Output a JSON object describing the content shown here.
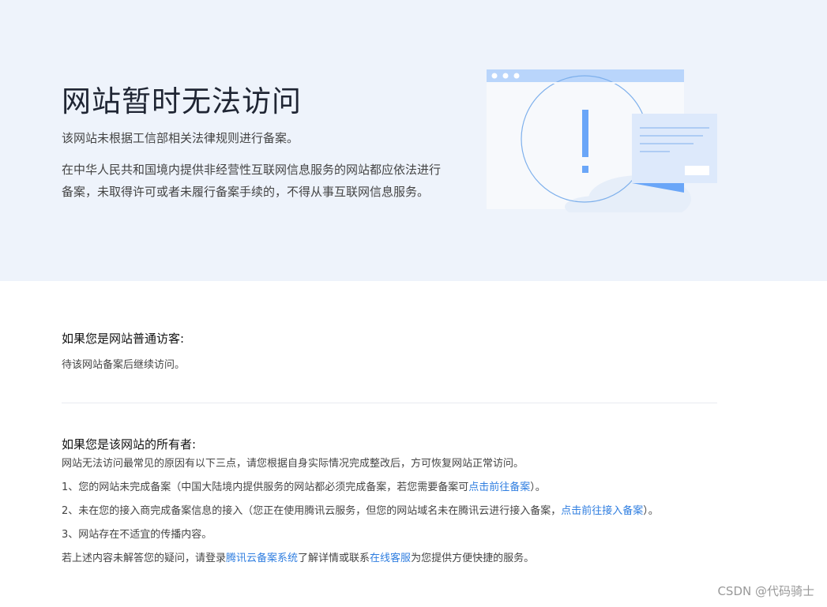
{
  "hero": {
    "title": "网站暂时无法访问",
    "subtitle": "该网站未根据工信部相关法律规则进行备案。",
    "description": "在中华人民共和国境内提供非经营性互联网信息服务的网站都应依法进行备案，未取得许可或者未履行备案手续的，不得从事互联网信息服务。"
  },
  "visitor": {
    "title": "如果您是网站普通访客:",
    "text": "待该网站备案后继续访问。"
  },
  "owner": {
    "title": "如果您是该网站的所有者:",
    "intro": "网站无法访问最常见的原因有以下三点，请您根据自身实际情况完成整改后，方可恢复网站正常访问。",
    "item1_text": "1、您的网站未完成备案（中国大陆境内提供服务的网站都必须完成备案，若您需要备案可",
    "item1_link": "点击前往备案",
    "item1_end": "）。",
    "item2_text": "2、未在您的接入商完成备案信息的接入（您正在使用腾讯云服务，但您的网站域名未在腾讯云进行接入备案，",
    "item2_link": "点击前往接入备案",
    "item2_end": "）。",
    "item3_text": "3、网站存在不适宜的传播内容。",
    "footer_pre": "若上述内容未解答您的疑问，请登录",
    "footer_link1": "腾讯云备案系统",
    "footer_mid": "了解详情或联系",
    "footer_link2": "在线客服",
    "footer_post": "为您提供方便快捷的服务。"
  },
  "watermark": "CSDN @代码骑士",
  "colors": {
    "hero_bg": "#eef3fb",
    "link": "#2f7ee0",
    "accent": "#6aa6f8"
  }
}
